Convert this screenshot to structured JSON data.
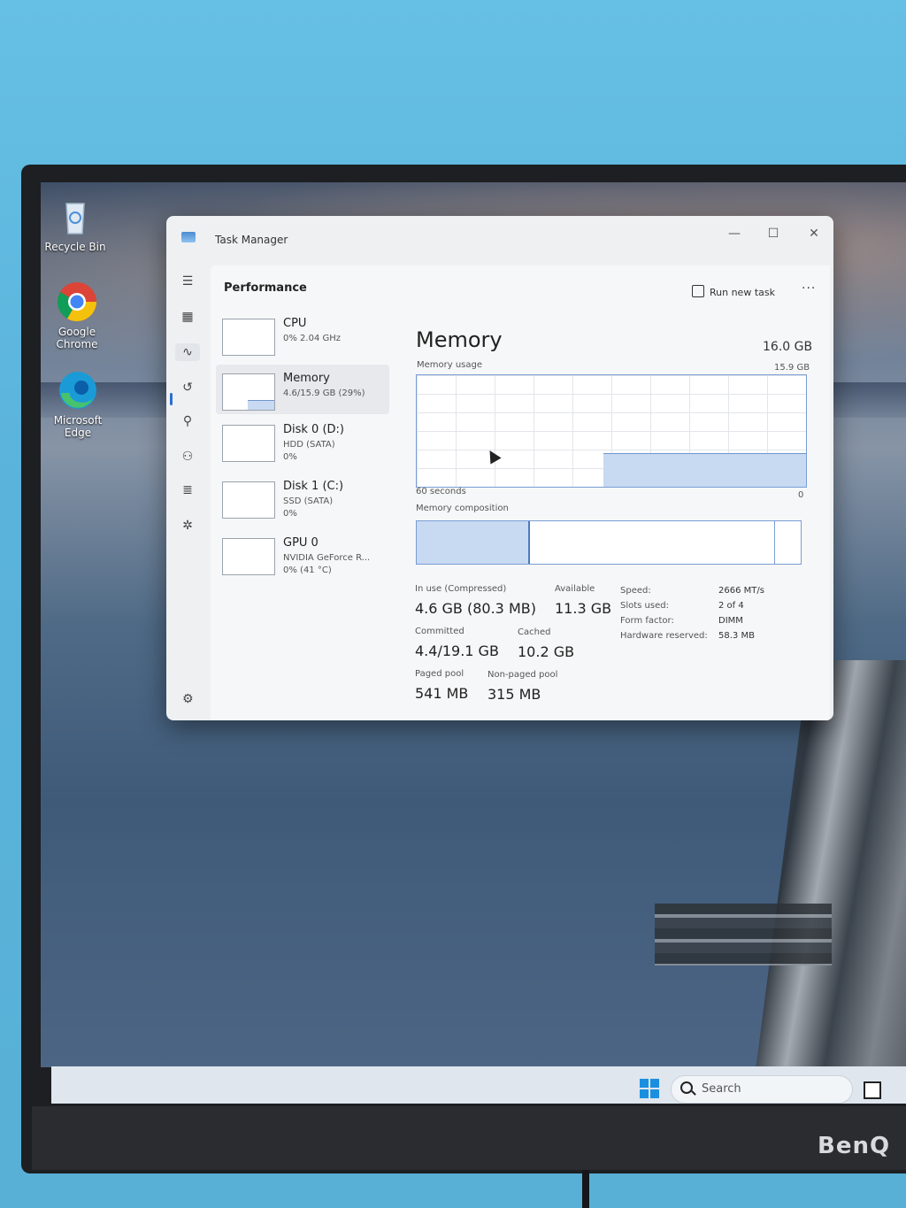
{
  "desktop": {
    "icons": [
      {
        "label": "Recycle Bin",
        "icon": "recycle-bin-icon"
      },
      {
        "label": "Google\nChrome",
        "icon": "chrome-icon"
      },
      {
        "label": "Microsoft\nEdge",
        "icon": "edge-icon"
      }
    ]
  },
  "taskbar": {
    "search_placeholder": "Search"
  },
  "monitor": {
    "brand": "BenQ"
  },
  "window": {
    "title": "Task Manager",
    "minimize": "—",
    "maximize": "☐",
    "close": "✕"
  },
  "header": {
    "page_title": "Performance",
    "run_new_task": "Run new task",
    "more": "···"
  },
  "devices": [
    {
      "name": "CPU",
      "line1": "0%  2.04 GHz",
      "line2": ""
    },
    {
      "name": "Memory",
      "line1": "4.6/15.9 GB (29%)",
      "line2": ""
    },
    {
      "name": "Disk 0 (D:)",
      "line1": "HDD (SATA)",
      "line2": "0%"
    },
    {
      "name": "Disk 1 (C:)",
      "line1": "SSD (SATA)",
      "line2": "0%"
    },
    {
      "name": "GPU 0",
      "line1": "NVIDIA GeForce R...",
      "line2": "0%  (41 °C)"
    }
  ],
  "memory": {
    "title": "Memory",
    "total": "16.0 GB",
    "usage_label": "Memory usage",
    "usage_max": "15.9 GB",
    "time_label": "60 seconds",
    "time_end": "0",
    "usage_fraction": 0.29,
    "composition_label": "Memory composition",
    "composition": {
      "in_use": 0.29,
      "available_end": 0.93
    },
    "stats": {
      "in_use_label": "In use (Compressed)",
      "in_use_value": "4.6 GB (80.3 MB)",
      "available_label": "Available",
      "available_value": "11.3 GB",
      "committed_label": "Committed",
      "committed_value": "4.4/19.1 GB",
      "cached_label": "Cached",
      "cached_value": "10.2 GB",
      "paged_label": "Paged pool",
      "paged_value": "541 MB",
      "nonpaged_label": "Non-paged pool",
      "nonpaged_value": "315 MB"
    },
    "specs": [
      {
        "key": "Speed:",
        "value": "2666 MT/s"
      },
      {
        "key": "Slots used:",
        "value": "2 of 4"
      },
      {
        "key": "Form factor:",
        "value": "DIMM"
      },
      {
        "key": "Hardware reserved:",
        "value": "58.3 MB"
      }
    ]
  }
}
